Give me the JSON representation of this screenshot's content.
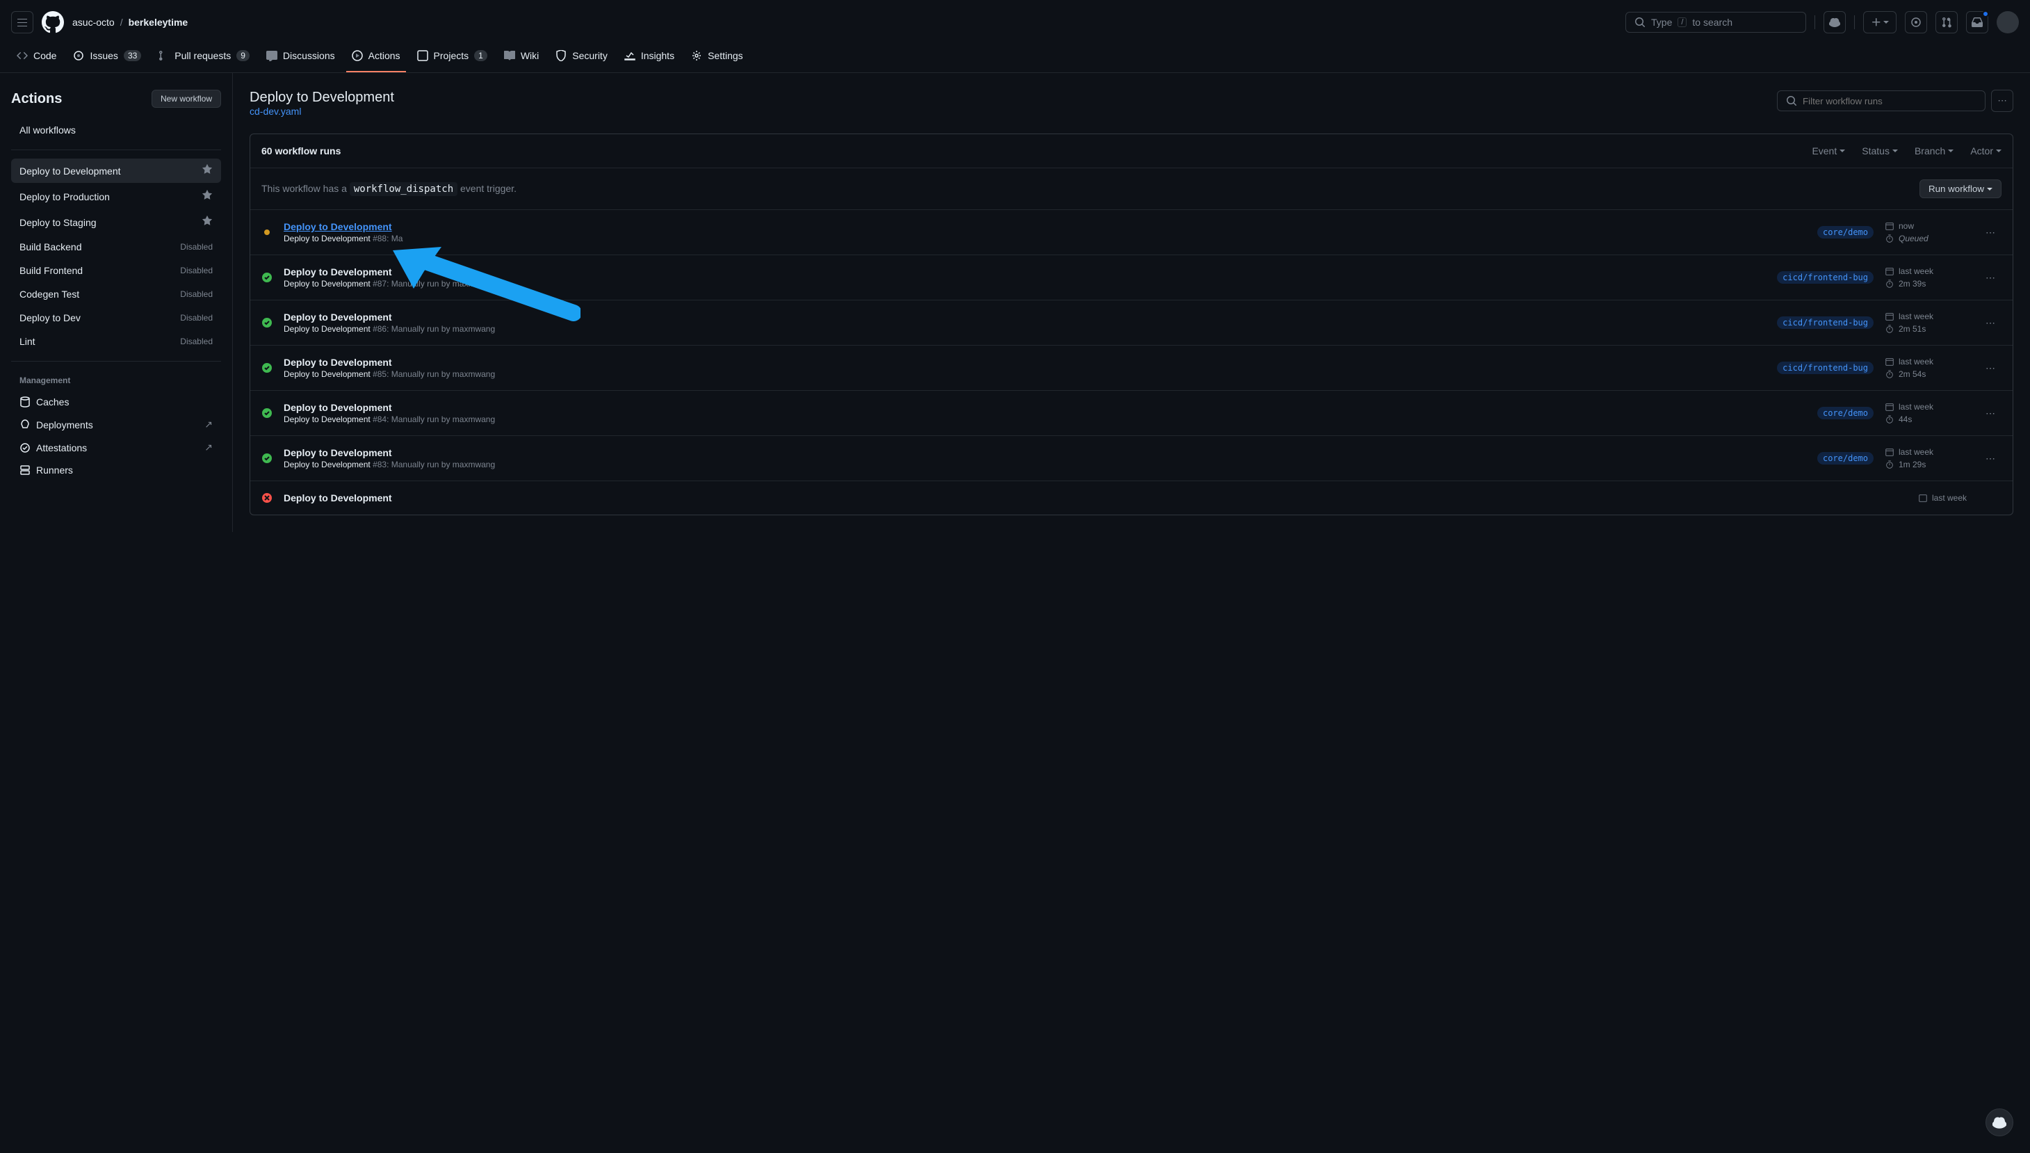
{
  "header": {
    "breadcrumb_org": "asuc-octo",
    "breadcrumb_repo": "berkeleytime",
    "search_prefix": "Type",
    "search_key": "/",
    "search_suffix": "to search"
  },
  "nav": {
    "code": "Code",
    "issues": "Issues",
    "issues_count": "33",
    "pulls": "Pull requests",
    "pulls_count": "9",
    "discussions": "Discussions",
    "actions": "Actions",
    "projects": "Projects",
    "projects_count": "1",
    "wiki": "Wiki",
    "security": "Security",
    "insights": "Insights",
    "settings": "Settings"
  },
  "sidebar": {
    "title": "Actions",
    "new_workflow": "New workflow",
    "all_workflows": "All workflows",
    "workflows": [
      {
        "name": "Deploy to Development",
        "state": "pin"
      },
      {
        "name": "Deploy to Production",
        "state": "pin"
      },
      {
        "name": "Deploy to Staging",
        "state": "pin"
      },
      {
        "name": "Build Backend",
        "state": "Disabled"
      },
      {
        "name": "Build Frontend",
        "state": "Disabled"
      },
      {
        "name": "Codegen Test",
        "state": "Disabled"
      },
      {
        "name": "Deploy to Dev",
        "state": "Disabled"
      },
      {
        "name": "Lint",
        "state": "Disabled"
      }
    ],
    "management_title": "Management",
    "management": [
      {
        "name": "Caches",
        "icon": "cache"
      },
      {
        "name": "Deployments",
        "icon": "rocket",
        "ext": true
      },
      {
        "name": "Attestations",
        "icon": "verified",
        "ext": true
      },
      {
        "name": "Runners",
        "icon": "server"
      }
    ]
  },
  "main": {
    "title": "Deploy to Development",
    "subtitle": "cd-dev.yaml",
    "filter_placeholder": "Filter workflow runs",
    "runs_count": "60 workflow runs",
    "filters": {
      "event": "Event",
      "status": "Status",
      "branch": "Branch",
      "actor": "Actor"
    },
    "dispatch_prefix": "This workflow has a ",
    "dispatch_code": "workflow_dispatch",
    "dispatch_suffix": " event trigger.",
    "run_workflow_btn": "Run workflow",
    "runs": [
      {
        "status": "pending",
        "title": "Deploy to Development",
        "meta_prefix": "Deploy to Development",
        "meta": " #88: Ma",
        "branch": "core/demo",
        "time": "now",
        "duration": "Queued"
      },
      {
        "status": "success",
        "title": "Deploy to Development",
        "meta_prefix": "Deploy to Development",
        "meta": " #87: Manually run by maxmwang",
        "branch": "cicd/frontend-bug",
        "time": "last week",
        "duration": "2m 39s"
      },
      {
        "status": "success",
        "title": "Deploy to Development",
        "meta_prefix": "Deploy to Development",
        "meta": " #86: Manually run by maxmwang",
        "branch": "cicd/frontend-bug",
        "time": "last week",
        "duration": "2m 51s"
      },
      {
        "status": "success",
        "title": "Deploy to Development",
        "meta_prefix": "Deploy to Development",
        "meta": " #85: Manually run by maxmwang",
        "branch": "cicd/frontend-bug",
        "time": "last week",
        "duration": "2m 54s"
      },
      {
        "status": "success",
        "title": "Deploy to Development",
        "meta_prefix": "Deploy to Development",
        "meta": " #84: Manually run by maxmwang",
        "branch": "core/demo",
        "time": "last week",
        "duration": "44s"
      },
      {
        "status": "success",
        "title": "Deploy to Development",
        "meta_prefix": "Deploy to Development",
        "meta": " #83: Manually run by maxmwang",
        "branch": "core/demo",
        "time": "last week",
        "duration": "1m 29s"
      },
      {
        "status": "failed",
        "title": "Deploy to Development",
        "meta_prefix": "",
        "meta": "",
        "branch": "",
        "time": "last week",
        "duration": ""
      }
    ]
  }
}
